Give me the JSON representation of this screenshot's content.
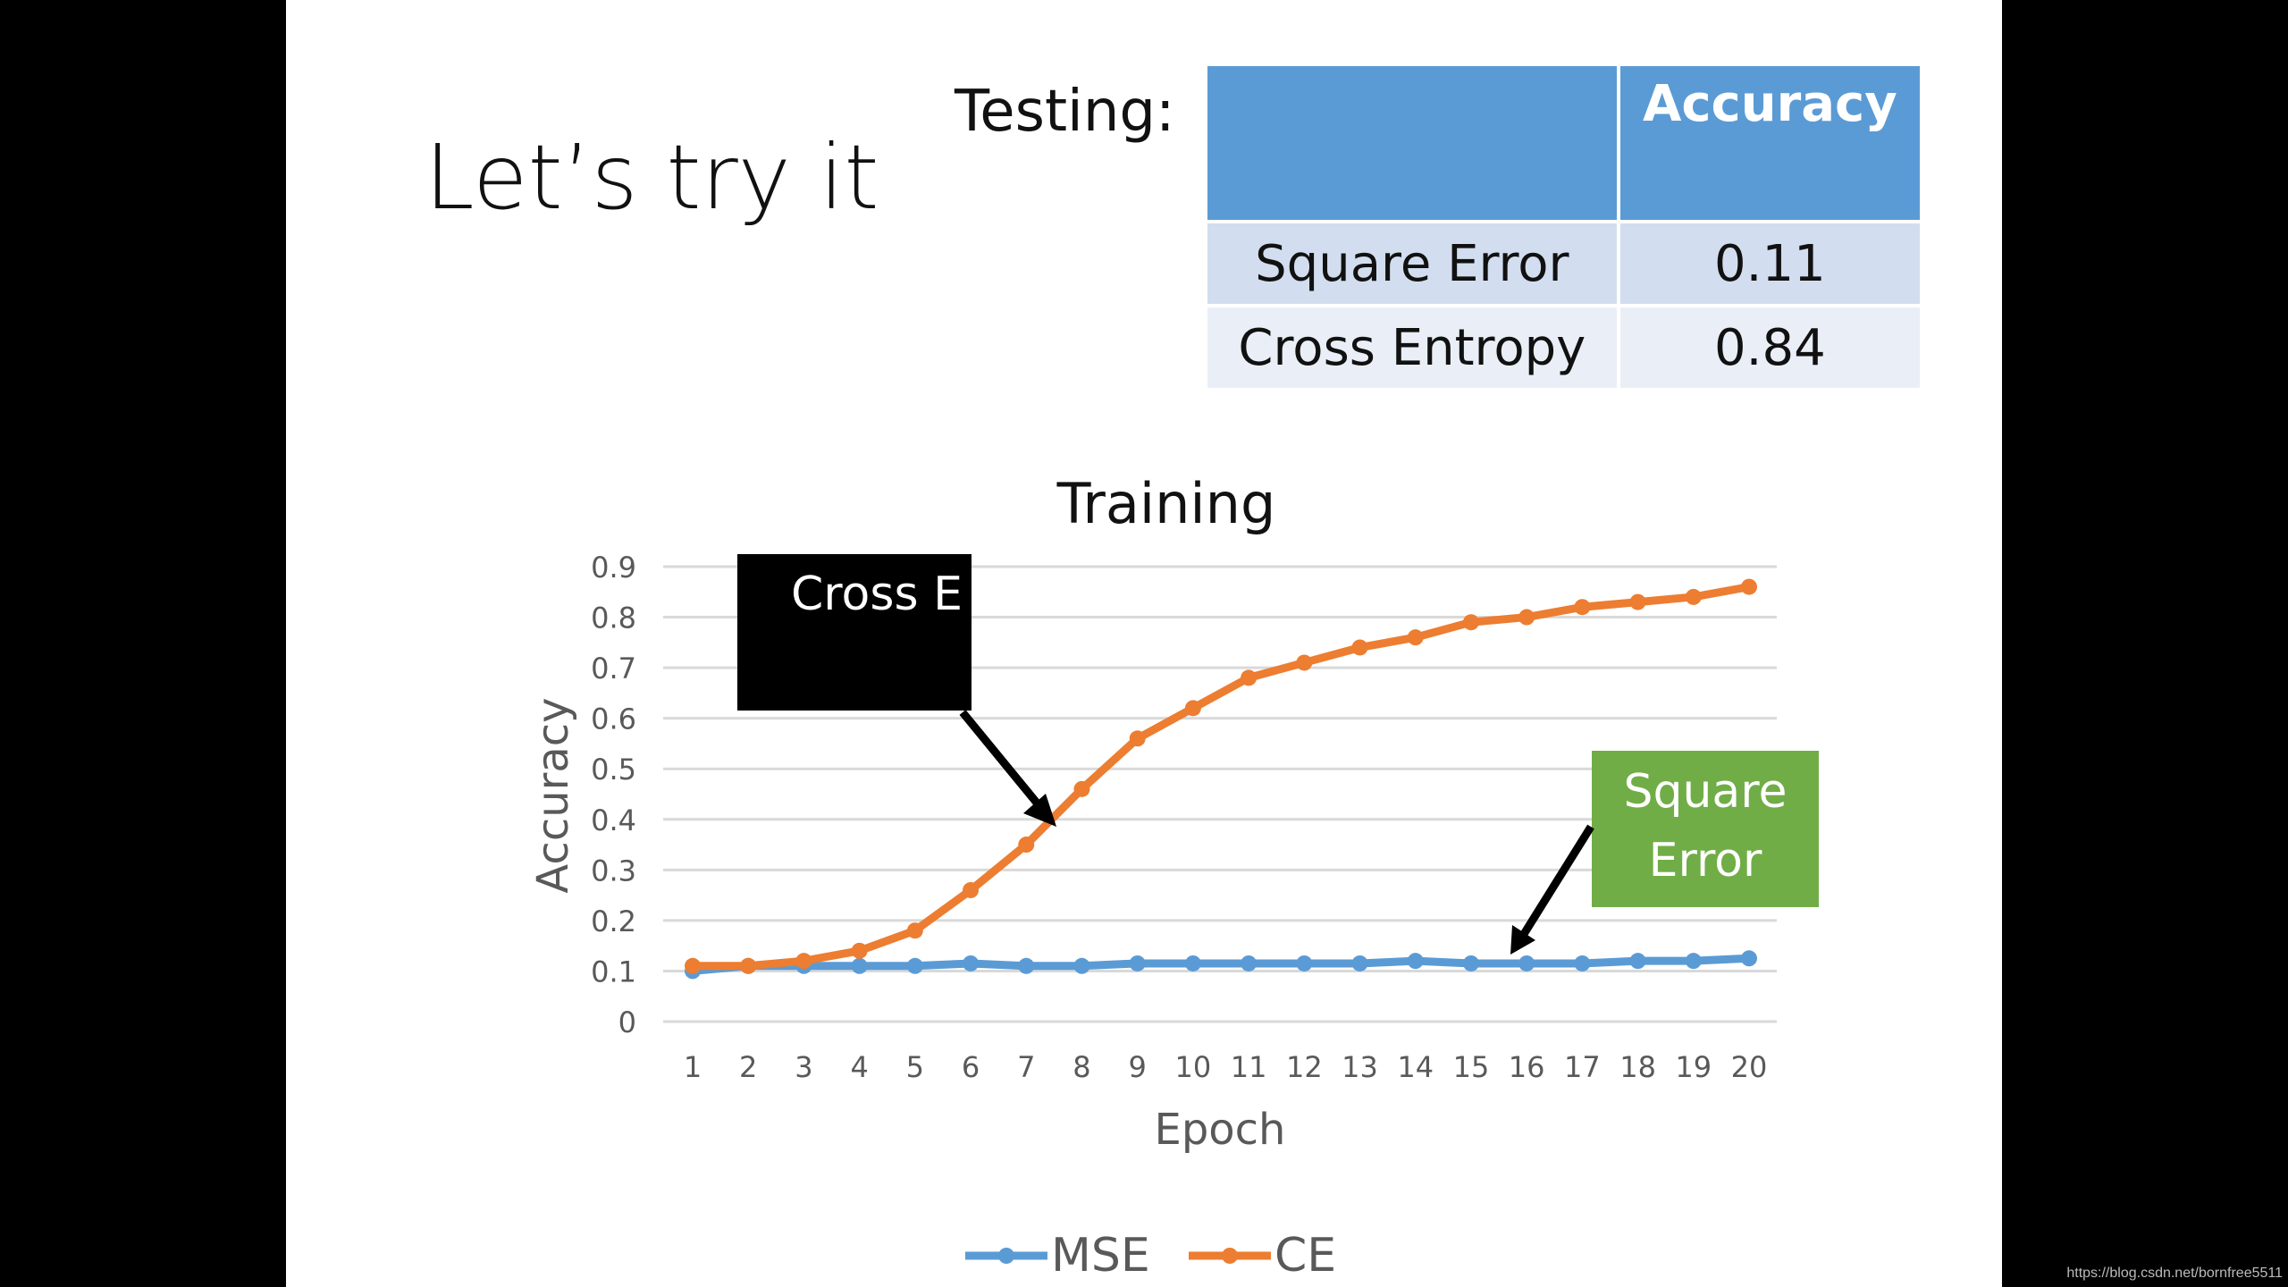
{
  "slide": {
    "title": "Let’s try it",
    "testing_label": "Testing:",
    "table": {
      "header": [
        "",
        "Accuracy"
      ],
      "rows": [
        {
          "method": "Square Error",
          "accuracy": "0.11"
        },
        {
          "method": "Cross Entropy",
          "accuracy": "0.84"
        }
      ],
      "header_color": "#5b9bd5"
    },
    "callouts": {
      "cross_entropy": "Cross  E",
      "square_error_line1": "Square",
      "square_error_line2": "Error"
    },
    "watermark": "https://blog.csdn.net/bornfree5511"
  },
  "chart_data": {
    "type": "line",
    "title": "Training",
    "xlabel": "Epoch",
    "ylabel": "Accuracy",
    "x": [
      1,
      2,
      3,
      4,
      5,
      6,
      7,
      8,
      9,
      10,
      11,
      12,
      13,
      14,
      15,
      16,
      17,
      18,
      19,
      20
    ],
    "yticks": [
      "0",
      "0.1",
      "0.2",
      "0.3",
      "0.4",
      "0.5",
      "0.6",
      "0.7",
      "0.8",
      "0.9"
    ],
    "ylim": [
      0,
      0.9
    ],
    "grid": true,
    "legend": "bottom",
    "series": [
      {
        "name": "MSE",
        "color": "#5b9bd5",
        "values": [
          0.1,
          0.11,
          0.11,
          0.11,
          0.11,
          0.115,
          0.11,
          0.11,
          0.115,
          0.115,
          0.115,
          0.115,
          0.115,
          0.12,
          0.115,
          0.115,
          0.115,
          0.12,
          0.12,
          0.125
        ]
      },
      {
        "name": "CE",
        "color": "#ed7d31",
        "values": [
          0.11,
          0.11,
          0.12,
          0.14,
          0.18,
          0.26,
          0.35,
          0.46,
          0.56,
          0.62,
          0.68,
          0.71,
          0.74,
          0.76,
          0.79,
          0.8,
          0.82,
          0.83,
          0.84,
          0.86
        ]
      }
    ]
  }
}
